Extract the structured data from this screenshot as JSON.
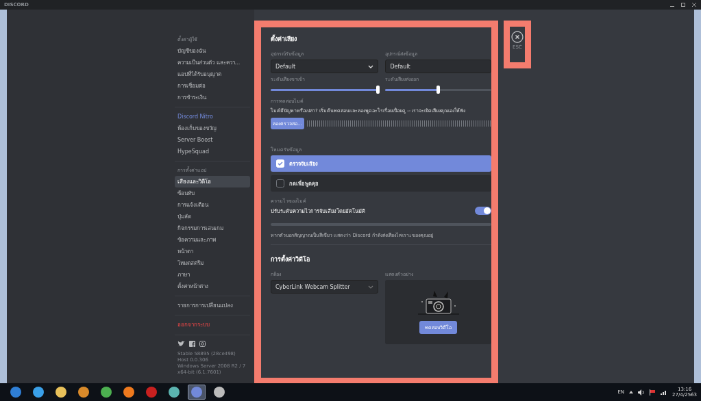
{
  "window": {
    "title": "DISCORD"
  },
  "sidebar": {
    "sections": [
      {
        "header": "ตั้งค่าผู้ใช้",
        "items": [
          {
            "label": "บัญชีของฉัน",
            "kind": "normal",
            "selected": false
          },
          {
            "label": "ความเป็นส่วนตัว และควา...",
            "kind": "normal",
            "selected": false
          },
          {
            "label": "แอปที่ได้รับอนุญาต",
            "kind": "normal",
            "selected": false
          },
          {
            "label": "การเชื่อมต่อ",
            "kind": "normal",
            "selected": false
          },
          {
            "label": "การชำระเงิน",
            "kind": "normal",
            "selected": false
          }
        ]
      },
      {
        "items": [
          {
            "label": "Discord Nitro",
            "kind": "nitro",
            "selected": false
          },
          {
            "label": "ห้องเก็บของขวัญ",
            "kind": "normal",
            "selected": false
          },
          {
            "label": "Server Boost",
            "kind": "normal",
            "selected": false
          },
          {
            "label": "HypeSquad",
            "kind": "normal",
            "selected": false
          }
        ]
      },
      {
        "header": "การตั้งค่าแอป",
        "items": [
          {
            "label": "เสียงและวิดีโอ",
            "kind": "normal",
            "selected": true
          },
          {
            "label": "ซ้อนทับ",
            "kind": "normal",
            "selected": false
          },
          {
            "label": "การแจ้งเตือน",
            "kind": "normal",
            "selected": false
          },
          {
            "label": "ปุ่มลัด",
            "kind": "normal",
            "selected": false
          },
          {
            "label": "กิจกรรมการเล่นเกม",
            "kind": "normal",
            "selected": false
          },
          {
            "label": "ข้อความและภาพ",
            "kind": "normal",
            "selected": false
          },
          {
            "label": "หน้าตา",
            "kind": "normal",
            "selected": false
          },
          {
            "label": "โหมดสตรีม",
            "kind": "normal",
            "selected": false
          },
          {
            "label": "ภาษา",
            "kind": "normal",
            "selected": false
          },
          {
            "label": "ตั้งค่าหน้าต่าง",
            "kind": "normal",
            "selected": false
          }
        ]
      },
      {
        "items": [
          {
            "label": "รายการการเปลี่ยนแปลง",
            "kind": "normal",
            "selected": false
          }
        ]
      },
      {
        "items": [
          {
            "label": "ออกจากระบบ",
            "kind": "danger",
            "selected": false
          }
        ]
      }
    ],
    "version": [
      "Stable 58895 (28ce498)",
      "Host 0.0.306",
      "Windows Server 2008 R2 / 7 x64-bit (6.1.7601)"
    ]
  },
  "voice": {
    "title": "ตั้งค่าเสียง",
    "input_device": {
      "label": "อุปกรณ์รับข้อมูล",
      "value": "Default"
    },
    "output_device": {
      "label": "อุปกรณ์ส่งข้อมูล",
      "value": "Default"
    },
    "input_volume": {
      "label": "ระดับเสียงขาเข้า",
      "level": 1
    },
    "output_volume": {
      "label": "ระดับเสียงส่งออก",
      "level": 0.5
    },
    "mic_test": {
      "label": "การทดสอบไมค์",
      "description": "ไมค์มีปัญหาหรือเปล่า? เริ่มต้นทดสอบและลองพูดอะไรเรื่อยเปื่อยดู -- เราจะเปิดเสียงคุณเองให้ฟัง",
      "button": "ลองตรวจสอ..."
    },
    "input_mode": {
      "label": "โหมดรับข้อมูล",
      "options": [
        {
          "label": "ตรวจจับเสียง",
          "selected": true
        },
        {
          "label": "กดเพื่อพูดคุย",
          "selected": false
        }
      ]
    },
    "sensitivity": {
      "label": "ความไวของไมค์",
      "toggle_label": "ปรับระดับความไวการจับเสียงโดยอัตโนมัติ",
      "on": true,
      "hint": "หากตัวบอกสัญญาณเป็นสีเขียว แสดงว่า Discord กำลังส่งเสียงไพเราะของคุณอยู่"
    }
  },
  "video": {
    "title": "การตั้งค่าวิดีโอ",
    "camera": {
      "label": "กล้อง",
      "value": "CyberLink Webcam Splitter"
    },
    "preview": {
      "label": "แสดงตัวอย่าง",
      "button": "ทดสอบวิดีโอ"
    }
  },
  "close": {
    "label": "ESC"
  },
  "taskbar": {
    "language": "EN",
    "time": "13:16",
    "date": "27/4/2563"
  }
}
